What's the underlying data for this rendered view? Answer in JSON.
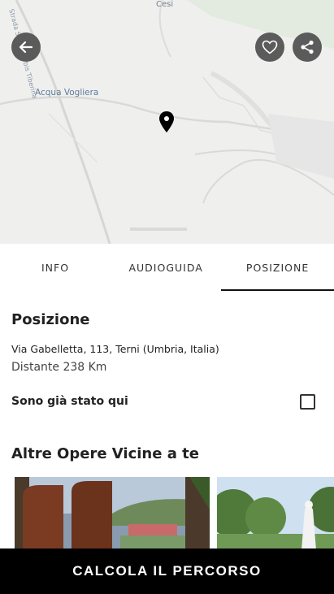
{
  "map": {
    "labels": {
      "cesi": "Cesi",
      "acqua_vogliera": "Acqua Vogliera",
      "road": "Strada Statale 3 bis Tiberina"
    }
  },
  "tabs": [
    {
      "label": "INFO",
      "active": false
    },
    {
      "label": "AUDIOGUIDA",
      "active": false
    },
    {
      "label": "POSIZIONE",
      "active": true
    }
  ],
  "position": {
    "title": "Posizione",
    "address": "Via Gabelletta, 113, Terni (Umbria, Italia)",
    "distance": "Distante 238 Km",
    "visited_label": "Sono già stato qui",
    "visited_checked": false
  },
  "nearby": {
    "title": "Altre Opere Vicine a te"
  },
  "cta": {
    "label": "CALCOLA IL PERCORSO"
  },
  "colors": {
    "icon_button_bg": "#5b5b5b",
    "cta_bg": "#000000"
  }
}
